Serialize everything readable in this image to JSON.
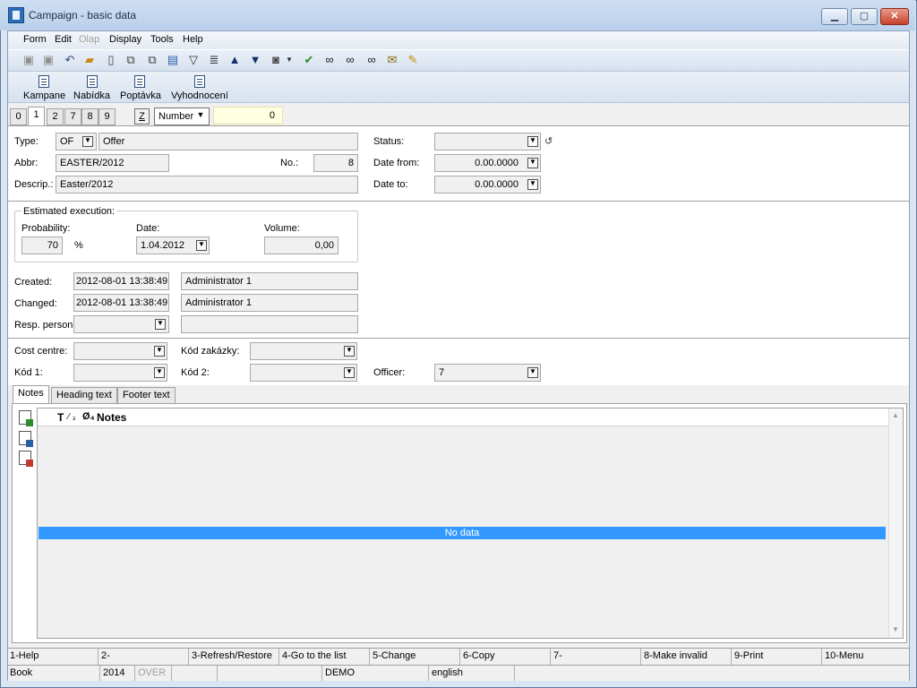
{
  "window": {
    "title": "Campaign - basic data",
    "buttons": {
      "minimize": "▁",
      "maximize": "▢",
      "close": "✕"
    }
  },
  "menu": [
    {
      "label": "Form",
      "enabled": true
    },
    {
      "label": "Edit",
      "enabled": true
    },
    {
      "label": "Olap",
      "enabled": false
    },
    {
      "label": "Display",
      "enabled": true
    },
    {
      "label": "Tools",
      "enabled": true
    },
    {
      "label": "Help",
      "enabled": true
    }
  ],
  "toolbar_icons": [
    "save-icon",
    "save-as-icon",
    "undo-icon",
    "open-folder-icon",
    "new-document-icon",
    "copy-document-icon",
    "paste-document-icon",
    "book-icon",
    "filter-icon",
    "filter-list-icon",
    "arrow-up-icon",
    "arrow-down-icon",
    "camera-icon",
    "dropdown-arrow-icon",
    "export-icon",
    "binoculars-icon",
    "find-next-icon",
    "find-all-icon",
    "mail-icon",
    "edit-note-icon"
  ],
  "links": [
    {
      "label": "Kampane"
    },
    {
      "label": "Nabídka"
    },
    {
      "label": "Poptávka"
    },
    {
      "label": "Vyhodnocení"
    }
  ],
  "page_tabs": [
    "0",
    "1",
    "2",
    "7",
    "8",
    "9"
  ],
  "active_page_tab": "1",
  "sort": {
    "z_label": "Z",
    "field": "Number",
    "value": "0"
  },
  "form": {
    "type": {
      "label": "Type:",
      "code": "OF",
      "name": "Offer"
    },
    "abbr": {
      "label": "Abbr:",
      "value": "EASTER/2012"
    },
    "no": {
      "label": "No.:",
      "value": "8"
    },
    "descrip": {
      "label": "Descrip.:",
      "value": "Easter/2012"
    },
    "status": {
      "label": "Status:",
      "value": ""
    },
    "date_from": {
      "label": "Date from:",
      "value": "0.00.0000"
    },
    "date_to": {
      "label": "Date to:",
      "value": "0.00.0000"
    },
    "estimated": {
      "title": "Estimated execution:",
      "probability_label": "Probability:",
      "probability": "70",
      "percent": "%",
      "date_label": "Date:",
      "date": "1.04.2012",
      "volume_label": "Volume:",
      "volume": "0,00"
    },
    "created": {
      "label": "Created:",
      "timestamp": "2012-08-01 13:38:49",
      "user": "Administrator 1"
    },
    "changed": {
      "label": "Changed:",
      "timestamp": "2012-08-01 13:38:49",
      "user": "Administrator 1"
    },
    "resp_person": {
      "label": "Resp. person:",
      "value": "",
      "name": ""
    },
    "cost_centre": {
      "label": "Cost centre:",
      "value": ""
    },
    "kod_zakazky": {
      "label": "Kód zakázky:",
      "value": ""
    },
    "kod1": {
      "label": "Kód 1:",
      "value": ""
    },
    "kod2": {
      "label": "Kód 2:",
      "value": ""
    },
    "officer": {
      "label": "Officer:",
      "value": "7"
    }
  },
  "bottom_tabs": [
    "Notes",
    "Heading text",
    "Footer text"
  ],
  "notes": {
    "header_t": "T",
    "header_frac": "⁄ ₃",
    "header_phi": "Ø₄",
    "header_label": "Notes",
    "empty": "No data"
  },
  "fkeys": [
    "1-Help",
    "2-",
    "3-Refresh/Restore",
    "4-Go to the list",
    "5-Change",
    "6-Copy",
    "7-",
    "8-Make invalid",
    "9-Print",
    "10-Menu"
  ],
  "status": {
    "book": "Book",
    "year": "2014",
    "over": "OVER",
    "blank1": "",
    "blank2": "",
    "db": "DEMO",
    "lang": "english"
  }
}
